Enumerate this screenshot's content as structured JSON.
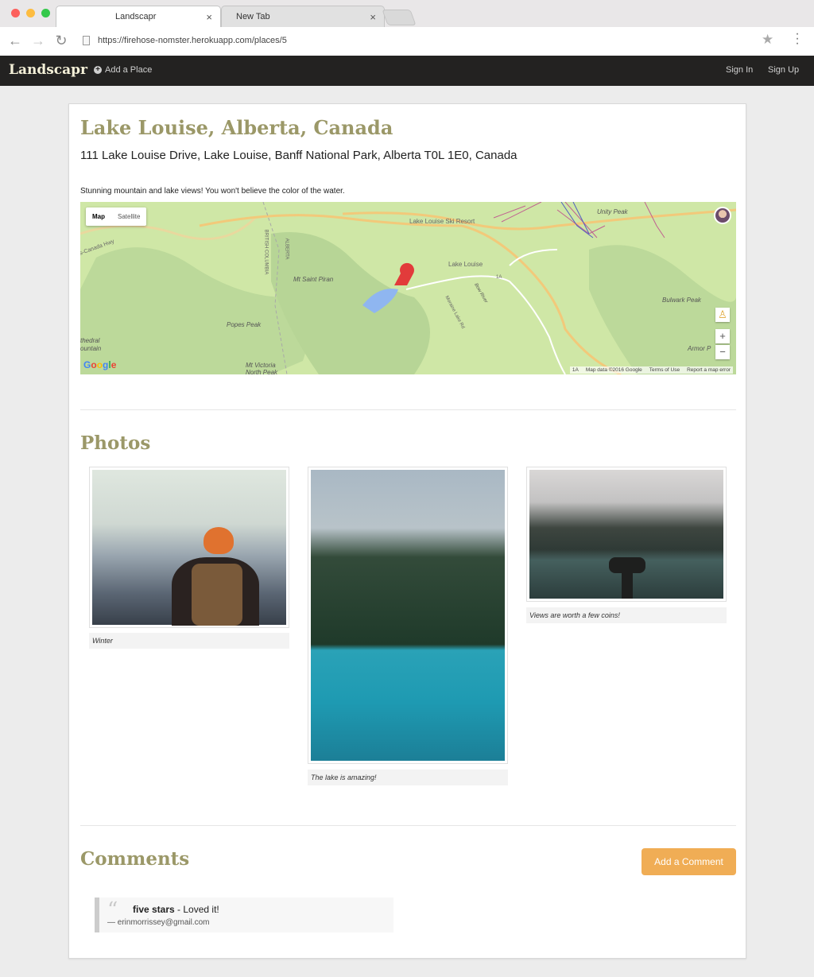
{
  "browser": {
    "active_tab": "Landscapr",
    "inactive_tab": "New Tab",
    "tab_close": "×",
    "url": "https://firehose-nomster.herokuapp.com/places/5"
  },
  "navbar": {
    "brand": "Landscapr",
    "add_place": "Add a Place",
    "sign_in": "Sign In",
    "sign_up": "Sign Up"
  },
  "place": {
    "name": "Lake Louise, Alberta, Canada",
    "address": "111 Lake Louise Drive, Lake Louise, Banff National Park, Alberta T0L 1E0, Canada",
    "description": "Stunning mountain and lake views! You won't believe the color of the water."
  },
  "map": {
    "type_map": "Map",
    "type_satellite": "Satellite",
    "labels": {
      "ski_resort": "Lake Louise Ski Resort",
      "unity_peak": "Unity Peak",
      "bc_border": "BRITISH COLUMBIA",
      "alberta_border": "ALBERTA",
      "canada_hwy": "s-Canada Hwy",
      "mt_saint_piran": "Mt Saint Piran",
      "lake_louise": "Lake Louise",
      "route_1a": "1A",
      "bow_river": "Bow River",
      "moraine_lake_rd": "Moraine Lake Rd",
      "bulwark_peak": "Bulwark Peak",
      "popes_peak": "Popes Peak",
      "cathedral_mountain": "thedral\nountain",
      "mt_victoria_north_peak": "Mt Victoria\nNorth Peak",
      "armor_p": "Armor P"
    },
    "google": "Google",
    "attribution": {
      "scale": "1A",
      "data": "Map data ©2016 Google",
      "terms": "Terms of Use",
      "report": "Report a map error"
    },
    "zoom_in": "+",
    "zoom_out": "−"
  },
  "photos": {
    "heading": "Photos",
    "items": [
      {
        "caption": "Winter"
      },
      {
        "caption": "The lake is amazing!"
      },
      {
        "caption": "Views are worth a few coins!"
      }
    ]
  },
  "comments": {
    "heading": "Comments",
    "add_button": "Add a Comment",
    "items": [
      {
        "rating": "five stars",
        "text": " - Loved it!",
        "author": "— erinmorrissey@gmail.com"
      }
    ]
  },
  "colors": {
    "accent_heading": "#9b9868",
    "navbar_bg": "#232221",
    "button_orange": "#f0ad55",
    "map_green": "#cfe7a6"
  }
}
